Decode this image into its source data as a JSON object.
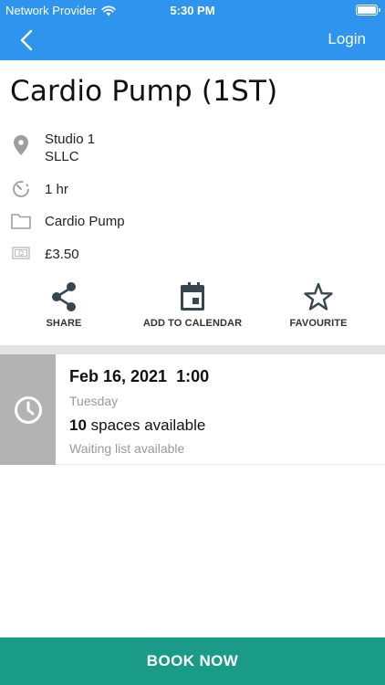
{
  "status_bar": {
    "carrier": "Network Provider",
    "time": "5:30 PM"
  },
  "nav": {
    "login_label": "Login"
  },
  "class": {
    "title": "Cardio Pump (1ST)",
    "location_line1": "Studio 1",
    "location_line2": "SLLC",
    "duration": "1 hr",
    "category": "Cardio Pump",
    "price": "£3.50"
  },
  "actions": {
    "share_label": "SHARE",
    "calendar_label": "ADD TO CALENDAR",
    "favourite_label": "FAVOURITE"
  },
  "session": {
    "date": "Feb 16, 2021  1:00",
    "day": "Tuesday",
    "spaces_count": "10",
    "spaces_text": " spaces available",
    "waiting": "Waiting list available"
  },
  "footer": {
    "book_label": "BOOK NOW"
  },
  "colors": {
    "header": "#2f94ee",
    "book_button": "#1a9b87",
    "icon_dark": "#37474f",
    "icon_grey": "#9e9e9e"
  }
}
